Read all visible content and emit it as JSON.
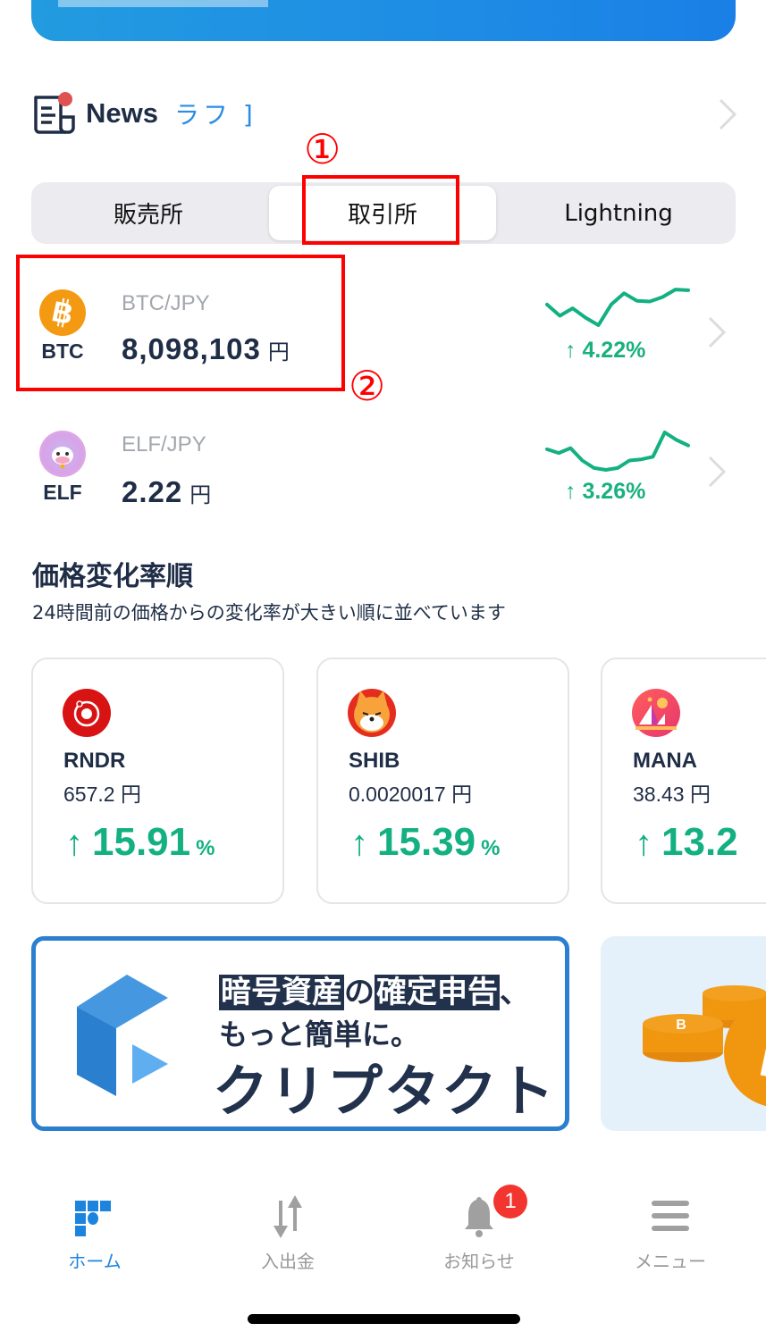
{
  "news": {
    "title": "News",
    "ticker_text": "ラフ ]"
  },
  "annotations": {
    "one": "①",
    "two": "②"
  },
  "segment": {
    "items": [
      {
        "label": "販売所",
        "active": false
      },
      {
        "label": "取引所",
        "active": true
      },
      {
        "label": "Lightning",
        "active": false
      }
    ]
  },
  "colors": {
    "accent": "#1d84de",
    "up": "#13b082",
    "annotation": "#ff0000",
    "badge": "#f2352e"
  },
  "markets": [
    {
      "symbol": "BTC",
      "pair": "BTC/JPY",
      "price": "8,098,103",
      "currency": "円",
      "change": "4.22%",
      "direction": "up",
      "sparkline": [
        0.55,
        0.25,
        0.45,
        0.2,
        0.0,
        0.55,
        0.85,
        0.65,
        0.63,
        0.75,
        0.95,
        0.93
      ]
    },
    {
      "symbol": "ELF",
      "pair": "ELF/JPY",
      "price": "2.22",
      "currency": "円",
      "change": "3.26%",
      "direction": "up",
      "sparkline": [
        0.55,
        0.45,
        0.58,
        0.25,
        0.05,
        0.0,
        0.05,
        0.25,
        0.28,
        0.35,
        1.0,
        0.8,
        0.65
      ]
    }
  ],
  "ranking": {
    "title": "価格変化率順",
    "subtitle": "24時間前の価格からの変化率が大きい順に並べています",
    "cards": [
      {
        "symbol": "RNDR",
        "price": "657.2 円",
        "change": "15.91",
        "unit": "%",
        "arrow": "↑"
      },
      {
        "symbol": "SHIB",
        "price": "0.0020017 円",
        "change": "15.39",
        "unit": "%",
        "arrow": "↑"
      },
      {
        "symbol": "MANA",
        "price": "38.43 円",
        "change": "13.2",
        "unit": "",
        "arrow": "↑"
      }
    ]
  },
  "ads": {
    "cryptact": {
      "line1a": "暗号資産",
      "line1b": "の",
      "line1c": "確定申告",
      "line1d": "、",
      "line2": "もっと簡単に。",
      "line3": "クリプタクト"
    }
  },
  "tabbar": {
    "items": [
      {
        "label": "ホーム",
        "icon": "home-icon",
        "active": true
      },
      {
        "label": "入出金",
        "icon": "transfer-icon",
        "active": false
      },
      {
        "label": "お知らせ",
        "icon": "bell-icon",
        "active": false
      },
      {
        "label": "メニュー",
        "icon": "menu-icon",
        "active": false
      }
    ],
    "notification_count": "1"
  }
}
